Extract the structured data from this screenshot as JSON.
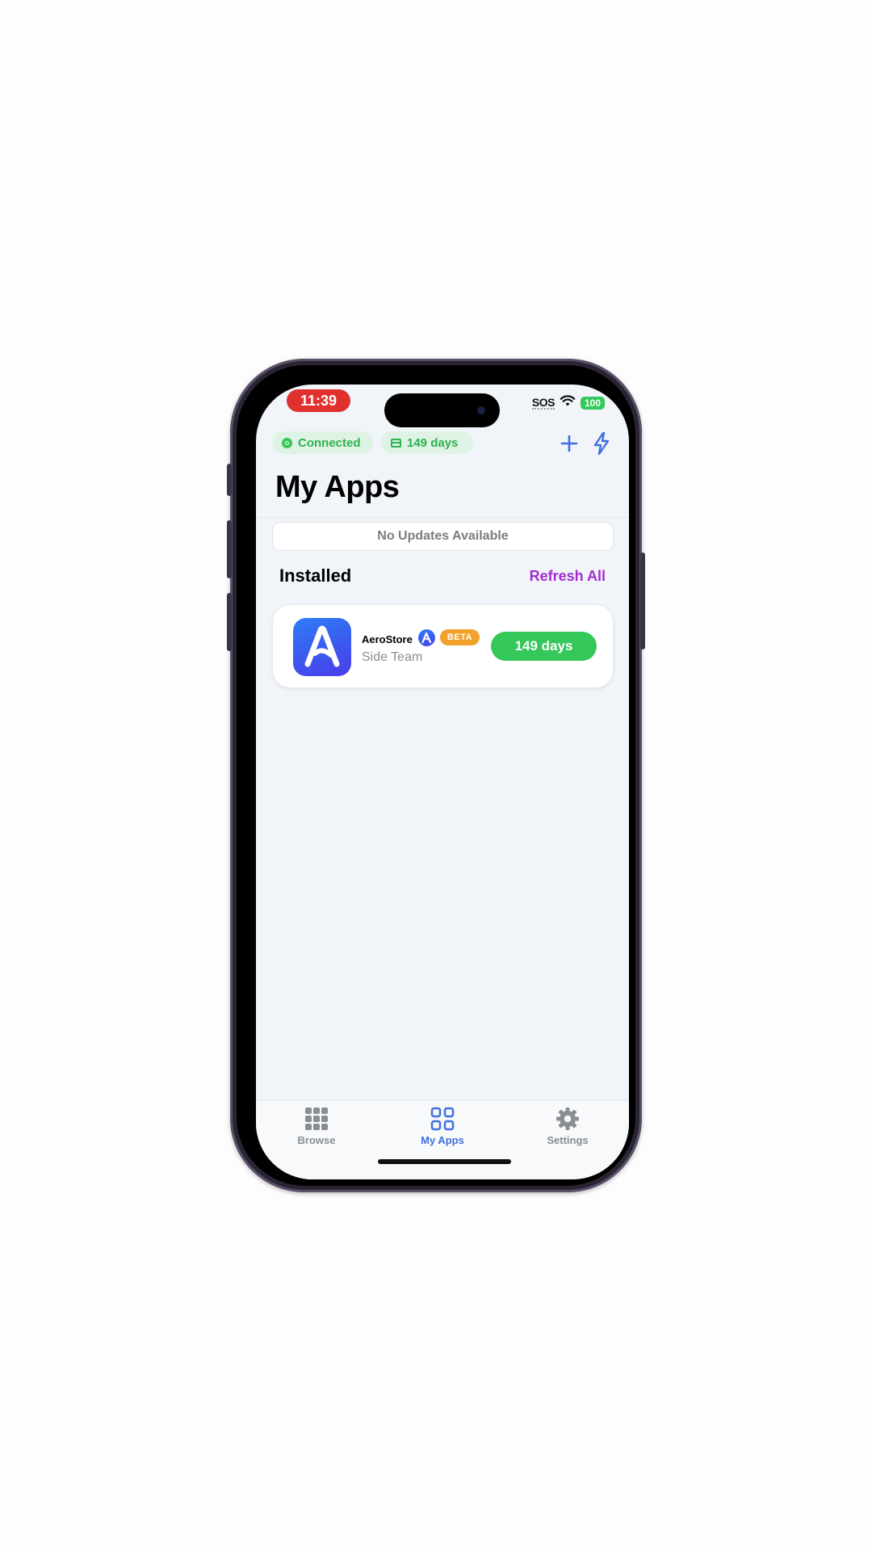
{
  "status_bar": {
    "time": "11:39",
    "carrier": "SOS",
    "battery": "100",
    "wifi_icon": "wifi-icon",
    "battery_color": "#34c759",
    "time_pill_color": "#e0312f"
  },
  "header": {
    "connection_status": "Connected",
    "days_remaining": "149 days",
    "add_icon": "plus-icon",
    "action_icon": "bolt-icon",
    "accent_color": "#3f6fe0"
  },
  "page": {
    "title": "My Apps",
    "updates_banner": "No Updates Available"
  },
  "installed": {
    "section_title": "Installed",
    "refresh_all_label": "Refresh All",
    "refresh_color": "#a52bd3",
    "apps": [
      {
        "name": "AeroStore",
        "badge": "BETA",
        "developer": "Side Team",
        "expiry_label": "149 days",
        "expiry_color": "#34c759"
      }
    ]
  },
  "tabbar": {
    "tabs": [
      {
        "label": "Browse",
        "icon": "grid-icon",
        "active": false
      },
      {
        "label": "My Apps",
        "icon": "apps-icon",
        "active": true
      },
      {
        "label": "Settings",
        "icon": "gear-icon",
        "active": false
      }
    ]
  }
}
